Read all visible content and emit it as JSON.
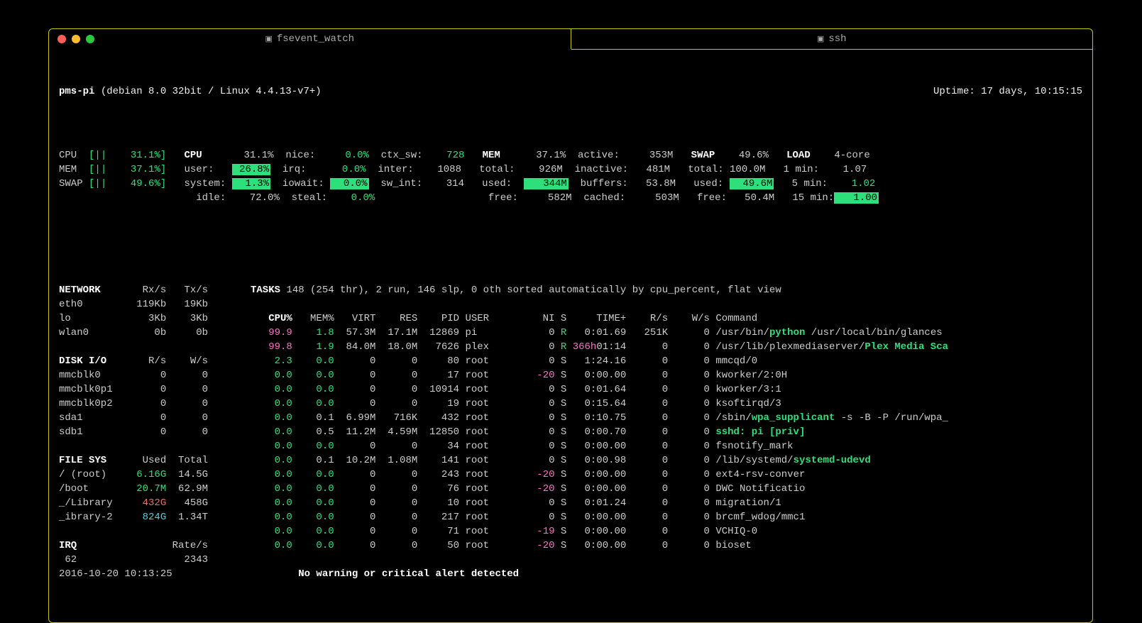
{
  "tabs": {
    "left": "fsevent_watch",
    "right": "ssh"
  },
  "host": "pms-pi",
  "sysinfo": "(debian 8.0 32bit / Linux 4.4.13-v7+)",
  "uptime_label": "Uptime:",
  "uptime": "17 days, 10:15:15",
  "mini": {
    "cpu": {
      "label": "CPU",
      "bar": "[||",
      "val": "31.1%]"
    },
    "mem": {
      "label": "MEM",
      "bar": "[||",
      "val": "37.1%]"
    },
    "swap": {
      "label": "SWAP",
      "bar": "[||",
      "val": "49.6%]"
    }
  },
  "cpu": {
    "label": "CPU",
    "total": "31.1%",
    "user_l": "user:",
    "user": "26.8%",
    "system_l": "system:",
    "system": "1.3%",
    "idle_l": "idle:",
    "idle": "72.0%",
    "nice_l": "nice:",
    "nice": "0.0%",
    "irq_l": "irq:",
    "irq": "0.0%",
    "iowait_l": "iowait:",
    "iowait": "0.0%",
    "steal_l": "steal:",
    "steal": "0.0%",
    "ctxsw_l": "ctx_sw:",
    "ctxsw": "728",
    "inter_l": "inter:",
    "inter": "1088",
    "swint_l": "sw_int:",
    "swint": "314"
  },
  "mem": {
    "label": "MEM",
    "total_pct": "37.1%",
    "total_l": "total:",
    "total": "926M",
    "used_l": "used:",
    "used": "344M",
    "free_l": "free:",
    "free": "582M",
    "active_l": "active:",
    "active": "353M",
    "inactive_l": "inactive:",
    "inactive": "481M",
    "buffers_l": "buffers:",
    "buffers": "53.8M",
    "cached_l": "cached:",
    "cached": "503M"
  },
  "swap": {
    "label": "SWAP",
    "pct": "49.6%",
    "total_l": "total:",
    "total": "100.0M",
    "used_l": "used:",
    "used": "49.6M",
    "free_l": "free:",
    "free": "50.4M"
  },
  "load": {
    "label": "LOAD",
    "cores": "4-core",
    "l1": "1 min:",
    "v1": "1.07",
    "l5": "5 min:",
    "v5": "1.02",
    "l15": "15 min:",
    "v15": "1.00"
  },
  "net": {
    "label": "NETWORK",
    "rx": "Rx/s",
    "tx": "Tx/s",
    "rows": [
      {
        "n": "eth0",
        "r": "119Kb",
        "t": "19Kb"
      },
      {
        "n": "lo",
        "r": "3Kb",
        "t": "3Kb"
      },
      {
        "n": "wlan0",
        "r": "0b",
        "t": "0b"
      }
    ]
  },
  "disk": {
    "label": "DISK I/O",
    "r": "R/s",
    "w": "W/s",
    "rows": [
      {
        "n": "mmcblk0",
        "r": "0",
        "w": "0"
      },
      {
        "n": "mmcblk0p1",
        "r": "0",
        "w": "0"
      },
      {
        "n": "mmcblk0p2",
        "r": "0",
        "w": "0"
      },
      {
        "n": "sda1",
        "r": "0",
        "w": "0"
      },
      {
        "n": "sdb1",
        "r": "0",
        "w": "0"
      }
    ]
  },
  "fs": {
    "label": "FILE SYS",
    "u": "Used",
    "t": "Total",
    "rows": [
      {
        "n": "/ (root)",
        "u": "6.16G",
        "uc": "g",
        "t": "14.5G"
      },
      {
        "n": "/boot",
        "u": "20.7M",
        "uc": "g",
        "t": "62.9M"
      },
      {
        "n": "_/Library",
        "u": "432G",
        "uc": "r",
        "t": "458G"
      },
      {
        "n": "_ibrary-2",
        "u": "824G",
        "uc": "c",
        "t": "1.34T"
      }
    ]
  },
  "irq": {
    "label": "IRQ",
    "rate_l": "Rate/s",
    "n": "62",
    "v": "2343"
  },
  "datetime": "2016-10-20 10:13:25",
  "tasks_line": "TASKS 148 (254 thr), 2 run, 146 slp, 0 oth sorted automatically by cpu_percent, flat view",
  "tasks_tasks": "TASKS",
  "tasks_rest": " 148 (254 thr), 2 run, 146 slp, 0 oth sorted automatically by cpu_percent, flat view",
  "proc_hdr": {
    "cpu": "CPU%",
    "mem": "MEM%",
    "virt": "VIRT",
    "res": "RES",
    "pid": "PID",
    "user": "USER",
    "ni": "NI",
    "s": "S",
    "time": "TIME+",
    "rs": "R/s",
    "ws": "W/s",
    "cmd": "Command"
  },
  "procs": [
    {
      "cpu": "99.9",
      "cpu_c": "m",
      "mem": "1.8",
      "mem_c": "g",
      "virt": "57.3M",
      "res": "17.1M",
      "pid": "12869",
      "user": "pi",
      "ni": "0",
      "s": "R",
      "s_c": "g",
      "time": "0:01.69",
      "time_hl": "",
      "rs": "251K",
      "ws": "0",
      "cmd_pre": "/usr/bin/",
      "cmd_hl": "python",
      "cmd_post": " /usr/local/bin/glances"
    },
    {
      "cpu": "99.8",
      "cpu_c": "m",
      "mem": "1.9",
      "mem_c": "g",
      "virt": "84.0M",
      "res": "18.0M",
      "pid": "7626",
      "user": "plex",
      "ni": "0",
      "s": "R",
      "s_c": "g",
      "time": "01:14",
      "time_hl": "366h",
      "rs": "0",
      "ws": "0",
      "cmd_pre": "/usr/lib/plexmediaserver/",
      "cmd_hl": "Plex Media Sca",
      "cmd_post": ""
    },
    {
      "cpu": "2.3",
      "cpu_c": "g",
      "mem": "0.0",
      "mem_c": "g",
      "virt": "0",
      "res": "0",
      "pid": "80",
      "user": "root",
      "ni": "0",
      "s": "S",
      "s_c": "",
      "time": "1:24.16",
      "time_hl": "",
      "rs": "0",
      "ws": "0",
      "cmd_pre": "mmcqd/0",
      "cmd_hl": "",
      "cmd_post": ""
    },
    {
      "cpu": "0.0",
      "cpu_c": "g",
      "mem": "0.0",
      "mem_c": "g",
      "virt": "0",
      "res": "0",
      "pid": "17",
      "user": "root",
      "ni": "-20",
      "ni_c": "m",
      "s": "S",
      "s_c": "",
      "time": "0:00.00",
      "time_hl": "",
      "rs": "0",
      "ws": "0",
      "cmd_pre": "kworker/2:0H",
      "cmd_hl": "",
      "cmd_post": ""
    },
    {
      "cpu": "0.0",
      "cpu_c": "g",
      "mem": "0.0",
      "mem_c": "g",
      "virt": "0",
      "res": "0",
      "pid": "10914",
      "user": "root",
      "ni": "0",
      "s": "S",
      "s_c": "",
      "time": "0:01.64",
      "time_hl": "",
      "rs": "0",
      "ws": "0",
      "cmd_pre": "kworker/3:1",
      "cmd_hl": "",
      "cmd_post": ""
    },
    {
      "cpu": "0.0",
      "cpu_c": "g",
      "mem": "0.0",
      "mem_c": "g",
      "virt": "0",
      "res": "0",
      "pid": "19",
      "user": "root",
      "ni": "0",
      "s": "S",
      "s_c": "",
      "time": "0:15.64",
      "time_hl": "",
      "rs": "0",
      "ws": "0",
      "cmd_pre": "ksoftirqd/3",
      "cmd_hl": "",
      "cmd_post": ""
    },
    {
      "cpu": "0.0",
      "cpu_c": "g",
      "mem": "0.1",
      "mem_c": "",
      "virt": "6.99M",
      "res": "716K",
      "pid": "432",
      "user": "root",
      "ni": "0",
      "s": "S",
      "s_c": "",
      "time": "0:10.75",
      "time_hl": "",
      "rs": "0",
      "ws": "0",
      "cmd_pre": "/sbin/",
      "cmd_hl": "wpa_supplicant",
      "cmd_post": " -s -B -P /run/wpa_"
    },
    {
      "cpu": "0.0",
      "cpu_c": "g",
      "mem": "0.5",
      "mem_c": "",
      "virt": "11.2M",
      "res": "4.59M",
      "pid": "12850",
      "user": "root",
      "ni": "0",
      "s": "S",
      "s_c": "",
      "time": "0:00.70",
      "time_hl": "",
      "rs": "0",
      "ws": "0",
      "cmd_pre": "",
      "cmd_hl": "sshd: pi [priv]",
      "cmd_post": ""
    },
    {
      "cpu": "0.0",
      "cpu_c": "g",
      "mem": "0.0",
      "mem_c": "g",
      "virt": "0",
      "res": "0",
      "pid": "34",
      "user": "root",
      "ni": "0",
      "s": "S",
      "s_c": "",
      "time": "0:00.00",
      "time_hl": "",
      "rs": "0",
      "ws": "0",
      "cmd_pre": "fsnotify_mark",
      "cmd_hl": "",
      "cmd_post": ""
    },
    {
      "cpu": "0.0",
      "cpu_c": "g",
      "mem": "0.1",
      "mem_c": "",
      "virt": "10.2M",
      "res": "1.08M",
      "pid": "141",
      "user": "root",
      "ni": "0",
      "s": "S",
      "s_c": "",
      "time": "0:00.98",
      "time_hl": "",
      "rs": "0",
      "ws": "0",
      "cmd_pre": "/lib/systemd/",
      "cmd_hl": "systemd-udevd",
      "cmd_post": ""
    },
    {
      "cpu": "0.0",
      "cpu_c": "g",
      "mem": "0.0",
      "mem_c": "g",
      "virt": "0",
      "res": "0",
      "pid": "243",
      "user": "root",
      "ni": "-20",
      "ni_c": "m",
      "s": "S",
      "s_c": "",
      "time": "0:00.00",
      "time_hl": "",
      "rs": "0",
      "ws": "0",
      "cmd_pre": "ext4-rsv-conver",
      "cmd_hl": "",
      "cmd_post": ""
    },
    {
      "cpu": "0.0",
      "cpu_c": "g",
      "mem": "0.0",
      "mem_c": "g",
      "virt": "0",
      "res": "0",
      "pid": "76",
      "user": "root",
      "ni": "-20",
      "ni_c": "m",
      "s": "S",
      "s_c": "",
      "time": "0:00.00",
      "time_hl": "",
      "rs": "0",
      "ws": "0",
      "cmd_pre": "DWC Notificatio",
      "cmd_hl": "",
      "cmd_post": ""
    },
    {
      "cpu": "0.0",
      "cpu_c": "g",
      "mem": "0.0",
      "mem_c": "g",
      "virt": "0",
      "res": "0",
      "pid": "10",
      "user": "root",
      "ni": "0",
      "s": "S",
      "s_c": "",
      "time": "0:01.24",
      "time_hl": "",
      "rs": "0",
      "ws": "0",
      "cmd_pre": "migration/1",
      "cmd_hl": "",
      "cmd_post": ""
    },
    {
      "cpu": "0.0",
      "cpu_c": "g",
      "mem": "0.0",
      "mem_c": "g",
      "virt": "0",
      "res": "0",
      "pid": "217",
      "user": "root",
      "ni": "0",
      "s": "S",
      "s_c": "",
      "time": "0:00.00",
      "time_hl": "",
      "rs": "0",
      "ws": "0",
      "cmd_pre": "brcmf_wdog/mmc1",
      "cmd_hl": "",
      "cmd_post": ""
    },
    {
      "cpu": "0.0",
      "cpu_c": "g",
      "mem": "0.0",
      "mem_c": "g",
      "virt": "0",
      "res": "0",
      "pid": "71",
      "user": "root",
      "ni": "-19",
      "ni_c": "m",
      "s": "S",
      "s_c": "",
      "time": "0:00.00",
      "time_hl": "",
      "rs": "0",
      "ws": "0",
      "cmd_pre": "VCHIQ-0",
      "cmd_hl": "",
      "cmd_post": ""
    },
    {
      "cpu": "0.0",
      "cpu_c": "g",
      "mem": "0.0",
      "mem_c": "g",
      "virt": "0",
      "res": "0",
      "pid": "50",
      "user": "root",
      "ni": "-20",
      "ni_c": "m",
      "s": "S",
      "s_c": "",
      "time": "0:00.00",
      "time_hl": "",
      "rs": "0",
      "ws": "0",
      "cmd_pre": "bioset",
      "cmd_hl": "",
      "cmd_post": ""
    }
  ],
  "alert": "No warning or critical alert detected"
}
